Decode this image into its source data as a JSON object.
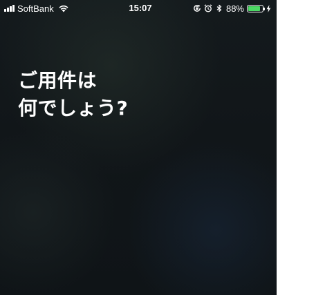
{
  "status_bar": {
    "carrier": "SoftBank",
    "time": "15:07",
    "battery_percent": "88%",
    "battery_level": 0.88,
    "battery_color": "#4cd964",
    "icons": {
      "signal": "cell-signal-icon",
      "wifi": "wifi-icon",
      "rotation_lock": "rotation-lock-icon",
      "alarm": "alarm-icon",
      "bluetooth": "bluetooth-icon",
      "battery": "battery-icon",
      "charging": "charging-bolt-icon"
    }
  },
  "siri": {
    "prompt_lines": [
      "ご用件は",
      "何でしょう?"
    ]
  },
  "colors": {
    "background": "#121719",
    "text": "#ffffff"
  }
}
